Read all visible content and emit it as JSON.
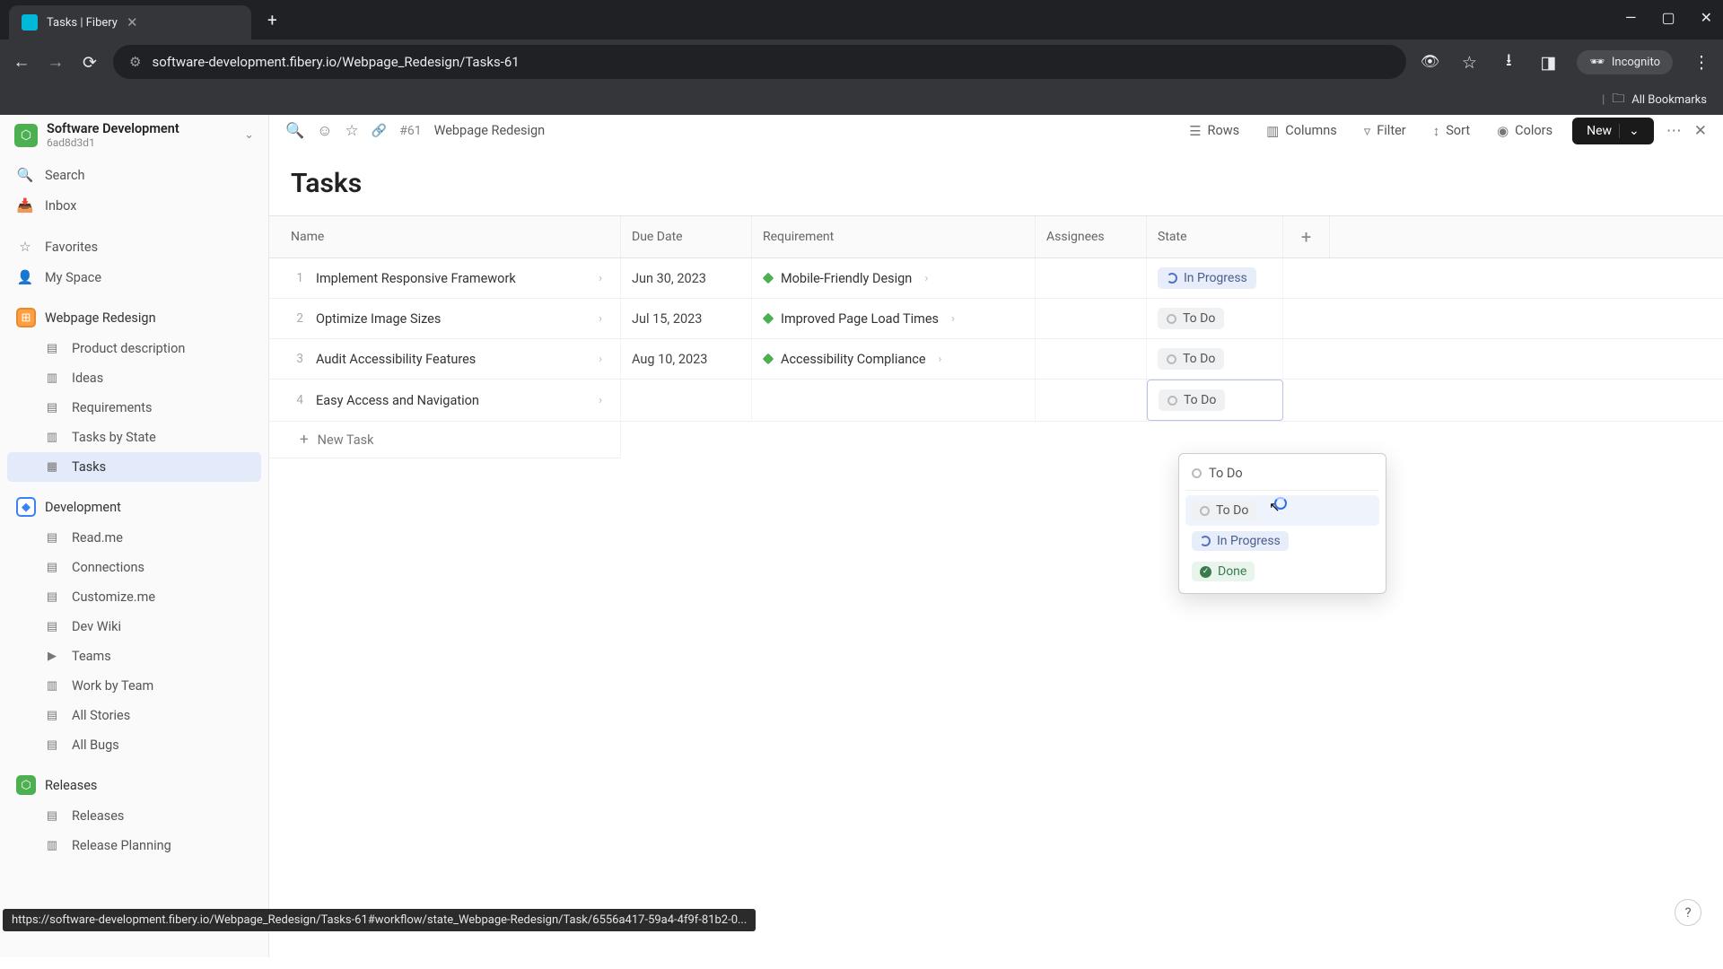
{
  "browser": {
    "tab_title": "Tasks | Fibery",
    "url": "software-development.fibery.io/Webpage_Redesign/Tasks-61",
    "incognito_label": "Incognito",
    "bookmarks_label": "All Bookmarks"
  },
  "workspace": {
    "name": "Software Development",
    "id": "6ad8d3d1"
  },
  "sidebar": {
    "search": "Search",
    "inbox": "Inbox",
    "favorites": "Favorites",
    "myspace": "My Space",
    "spaces": [
      {
        "name": "Webpage Redesign",
        "items": [
          "Product description",
          "Ideas",
          "Requirements",
          "Tasks by State",
          "Tasks"
        ]
      },
      {
        "name": "Development",
        "items": [
          "Read.me",
          "Connections",
          "Customize.me",
          "Dev Wiki",
          "Teams",
          "Work by Team",
          "All Stories",
          "All Bugs"
        ]
      },
      {
        "name": "Releases",
        "items": [
          "Releases",
          "Release Planning"
        ]
      }
    ]
  },
  "breadcrumb": {
    "id": "#61",
    "title": "Webpage Redesign"
  },
  "toolbar": {
    "rows": "Rows",
    "columns": "Columns",
    "filter": "Filter",
    "sort": "Sort",
    "colors": "Colors",
    "new": "New"
  },
  "page": {
    "title": "Tasks"
  },
  "table": {
    "headers": {
      "name": "Name",
      "due": "Due Date",
      "req": "Requirement",
      "assign": "Assignees",
      "state": "State"
    },
    "rows": [
      {
        "num": "1",
        "name": "Implement Responsive Framework",
        "due": "Jun 30, 2023",
        "req": "Mobile-Friendly Design",
        "state": "In Progress",
        "state_type": "progress"
      },
      {
        "num": "2",
        "name": "Optimize Image Sizes",
        "due": "Jul 15, 2023",
        "req": "Improved Page Load Times",
        "state": "To Do",
        "state_type": "todo"
      },
      {
        "num": "3",
        "name": "Audit Accessibility Features",
        "due": "Aug 10, 2023",
        "req": "Accessibility Compliance",
        "state": "To Do",
        "state_type": "todo"
      },
      {
        "num": "4",
        "name": "Easy Access and Navigation",
        "due": "",
        "req": "",
        "state": "To Do",
        "state_type": "todo",
        "active": true
      }
    ],
    "new_task": "New Task"
  },
  "state_dropdown": {
    "input_value": "To Do",
    "options": [
      {
        "label": "To Do",
        "type": "todo",
        "hover": true
      },
      {
        "label": "In Progress",
        "type": "progress"
      },
      {
        "label": "Done",
        "type": "done"
      }
    ]
  },
  "status_url": "https://software-development.fibery.io/Webpage_Redesign/Tasks-61#workflow/state_Webpage-Redesign/Task/6556a417-59a4-4f9f-81b2-0..."
}
